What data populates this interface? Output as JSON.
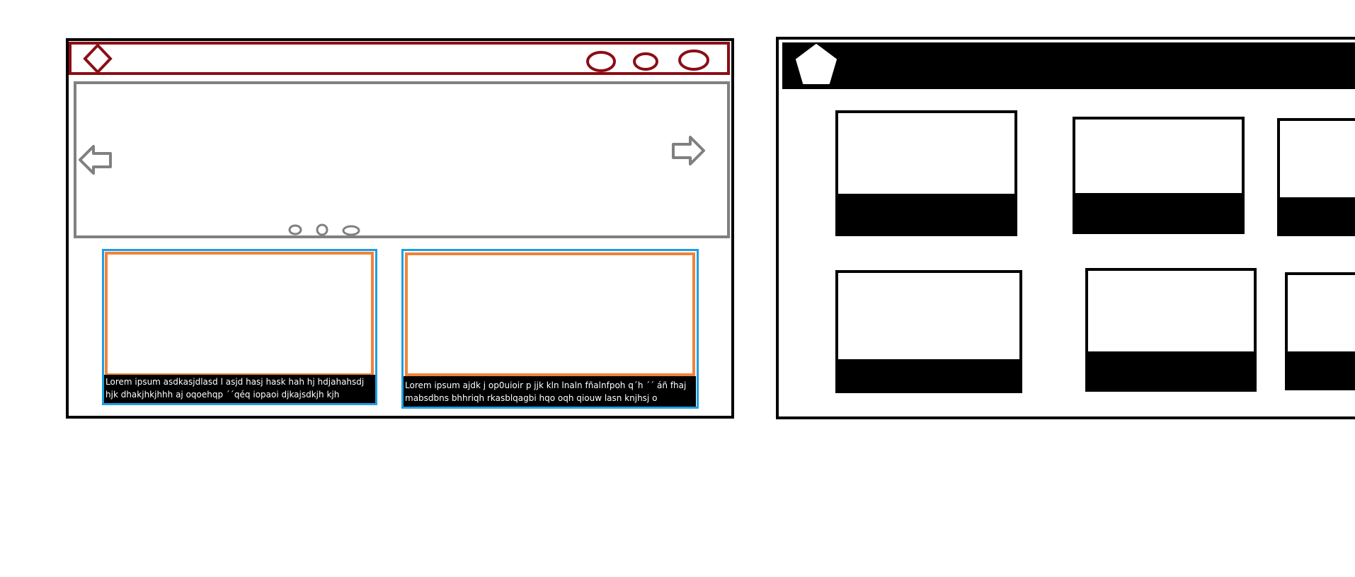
{
  "left_wireframe": {
    "header": {
      "logo_icon": "diamond-icon",
      "menu_icons": [
        "ellipse-icon",
        "ellipse-icon",
        "ellipse-icon"
      ],
      "accent_color": "#8b0e15"
    },
    "carousel": {
      "prev_icon": "arrow-left-icon",
      "next_icon": "arrow-right-icon",
      "indicator_count": 3,
      "color": "#808080"
    },
    "cards": [
      {
        "caption": "Lorem ipsum asdkasjdlasd l asjd hasj hask hah hj hdjahahsdj\nhjk dhakjhkjhhh aj oqoehqp ´´qéq iopaoi djkajsdkjh kjh"
      },
      {
        "caption": "Lorem ipsum ajdk j op0uioir p jjk kln lnaln fñalnfpoh q´h ´´ áñ fhaj\nmabsdbns bhhriqh rkasblqagbi hqo oqh qiouw lasn knjhsj o"
      }
    ],
    "card_border_color": "#1f9ee0",
    "card_inner_color": "#f0833a"
  },
  "right_wireframe": {
    "header": {
      "logo_icon": "pentagon-icon",
      "background_color": "#000000"
    },
    "tile_rows": 2,
    "tiles_per_row_visible": 3
  }
}
